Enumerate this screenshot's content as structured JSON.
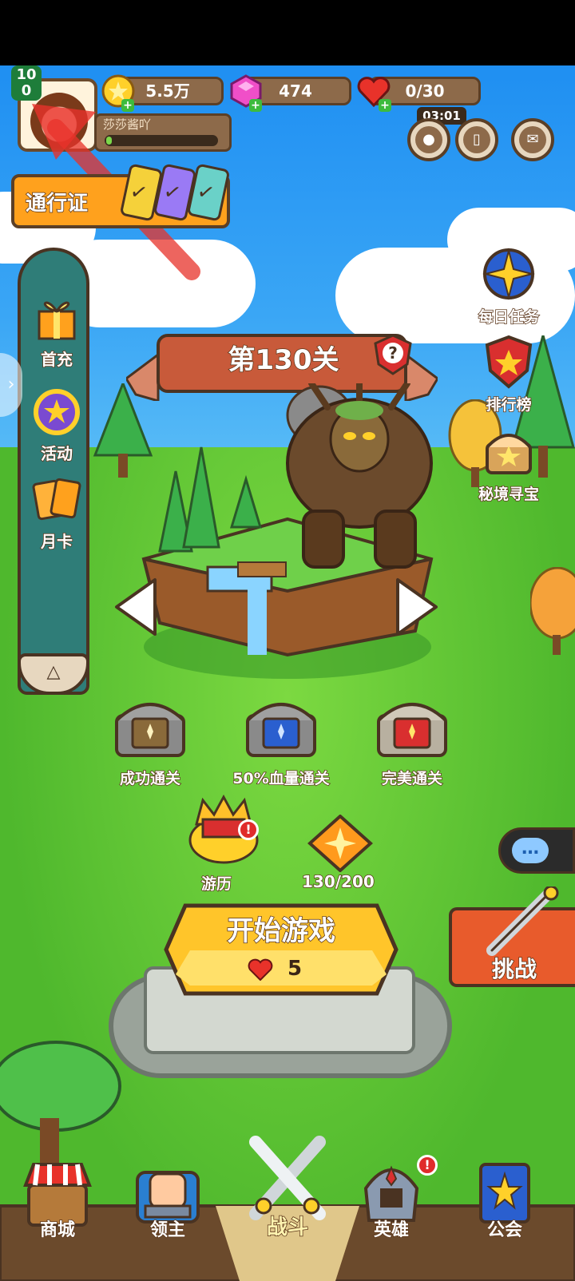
{
  "player": {
    "level_top": "10",
    "level_bottom": "0",
    "name": "莎莎酱吖",
    "exp_fraction": 0.05
  },
  "resources": {
    "gold": "5.5万",
    "gems": "474",
    "stamina": "0/30",
    "stamina_timer": "03:01"
  },
  "battle_pass": {
    "label": "通行证"
  },
  "left_menu": [
    {
      "label": "首充"
    },
    {
      "label": "活动"
    },
    {
      "label": "月卡"
    }
  ],
  "right_menu": [
    {
      "label": "每日任务"
    },
    {
      "label": "排行榜"
    },
    {
      "label": "秘境寻宝"
    }
  ],
  "stage": {
    "title": "第130关",
    "help_symbol": "?"
  },
  "chests": [
    {
      "label": "成功通关",
      "color": "#8a6a3a"
    },
    {
      "label": "50%血量通关",
      "color": "#2a5fcf"
    },
    {
      "label": "完美通关",
      "color": "#d92f2f"
    }
  ],
  "journey": {
    "label": "游历",
    "alert": "!"
  },
  "stars": {
    "progress": "130/200"
  },
  "start_button": {
    "label": "开始游戏",
    "cost": "5"
  },
  "challenge": {
    "label": "挑战"
  },
  "bottom_nav": [
    {
      "label": "商城"
    },
    {
      "label": "领主"
    },
    {
      "label": "战斗"
    },
    {
      "label": "英雄",
      "alert": "!"
    },
    {
      "label": "公会"
    }
  ],
  "colors": {
    "accent_orange": "#ffa11d",
    "frame_brown": "#4a3322",
    "grass_green": "#5fc532",
    "sky_blue": "#2b97f3"
  }
}
